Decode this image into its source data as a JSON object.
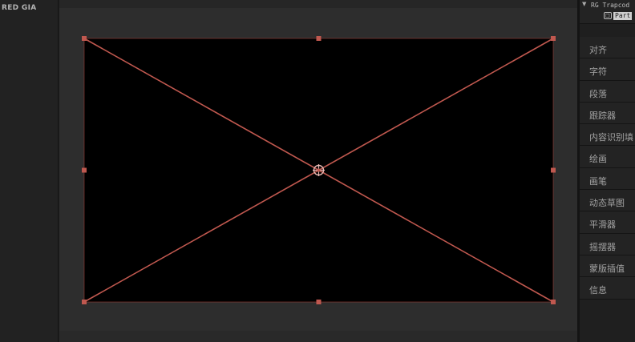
{
  "left_panel": {
    "label": "RED GIA"
  },
  "right_panel": {
    "layer_title": "RG Trapcod",
    "layer_tag": "Part",
    "panels": [
      {
        "label": "对齐"
      },
      {
        "label": "字符"
      },
      {
        "label": "段落"
      },
      {
        "label": "跟踪器"
      },
      {
        "label": "内容识别填"
      },
      {
        "label": "绘画"
      },
      {
        "label": "画笔"
      },
      {
        "label": "动态草图"
      },
      {
        "label": "平滑器"
      },
      {
        "label": "摇摆器"
      },
      {
        "label": "蒙版插值"
      },
      {
        "label": "信息"
      }
    ]
  },
  "colors": {
    "layer_outline": "#c0584f",
    "composition_bg": "#000000",
    "viewer_bg": "#2d2d2d"
  },
  "icons": {
    "anchor": "anchor-point-icon",
    "expand": "chevron-down-icon",
    "layer": "layer-icon"
  }
}
